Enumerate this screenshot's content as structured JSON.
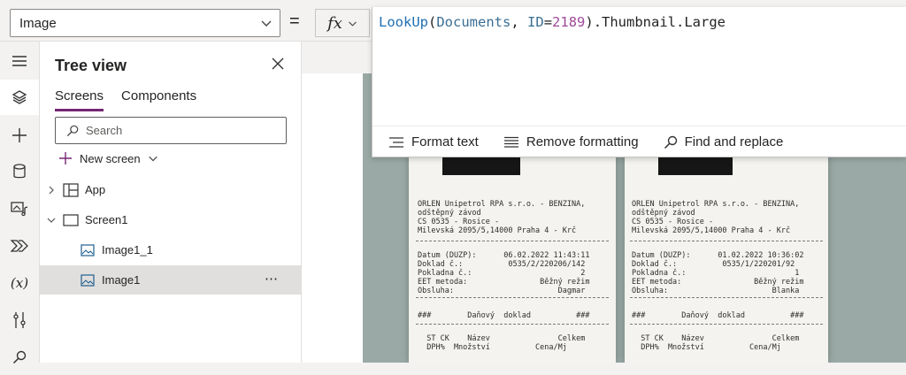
{
  "property_selector": {
    "value": "Image"
  },
  "formula_bar": {
    "equals": "=",
    "fx_label": "fx",
    "formula_tokens": [
      {
        "text": "LookUp",
        "kind": "fn"
      },
      {
        "text": "(",
        "kind": "plain"
      },
      {
        "text": "Documents",
        "kind": "id"
      },
      {
        "text": ", ",
        "kind": "plain"
      },
      {
        "text": "ID",
        "kind": "id"
      },
      {
        "text": "=",
        "kind": "plain"
      },
      {
        "text": "2189",
        "kind": "num"
      },
      {
        "text": ").Thumbnail.Large",
        "kind": "plain"
      }
    ],
    "toolbar": {
      "format_text": "Format text",
      "remove_formatting": "Remove formatting",
      "find_replace": "Find and replace"
    }
  },
  "rail": {
    "items": [
      {
        "icon": "hamburger-icon"
      },
      {
        "icon": "layers-icon",
        "active": true
      },
      {
        "icon": "plus-icon"
      },
      {
        "icon": "database-icon"
      },
      {
        "icon": "media-icon"
      },
      {
        "icon": "power-automate-icon"
      },
      {
        "icon": "variables-icon"
      },
      {
        "icon": "tools-icon"
      },
      {
        "icon": "search-icon"
      }
    ],
    "variables_glyph": "(x)"
  },
  "tree_view": {
    "title": "Tree view",
    "tabs": [
      "Screens",
      "Components"
    ],
    "search_placeholder": "Search",
    "new_screen": "New screen",
    "nodes": [
      {
        "label": "App",
        "type": "app"
      },
      {
        "label": "Screen1",
        "type": "screen"
      },
      {
        "label": "Image1_1",
        "type": "image"
      },
      {
        "label": "Image1",
        "type": "image",
        "selected": true
      }
    ],
    "more": "⋯"
  },
  "receipt_left": {
    "header_lines": [
      "ORLEN Unipetrol RPA s.r.o. - BENZINA,",
      "odštěpný závod",
      "CS 0535 - Rosice -",
      "Milevská 2095/5,14000 Praha 4 - Krč"
    ],
    "detail_lines": [
      "Datum (DUZP):      06.02.2022 11:43:11",
      "Doklad č.:          0535/2/220206/142",
      "Pokladna č.:                        2",
      "EET metoda:                Běžný režim",
      "Obsluha:                       Dagmar"
    ],
    "tax_line": "###        Daňový  doklad          ###",
    "item_lines": [
      "  ST CK    Název               Celkem",
      "  DPH%  Množství          Cena/Mj"
    ]
  },
  "receipt_right": {
    "header_lines": [
      "ORLEN Unipetrol RPA s.r.o. - BENZINA,",
      "odštěpný závod",
      "CS 0535 - Rosice -",
      "Milevská 2095/5,14000 Praha 4 - Krč"
    ],
    "detail_lines": [
      "Datum (DUZP):      01.02.2022 10:36:02",
      "Doklad č.:          0535/1/220201/92",
      "Pokladna č.:                        1",
      "EET metoda:                Běžný režim",
      "Obsluha:                       Blanka"
    ],
    "tax_line": "###        Daňový  doklad          ###",
    "item_lines": [
      "  ST CK    Název               Celkem",
      "  DPH%  Množství          Cena/Mj"
    ]
  }
}
